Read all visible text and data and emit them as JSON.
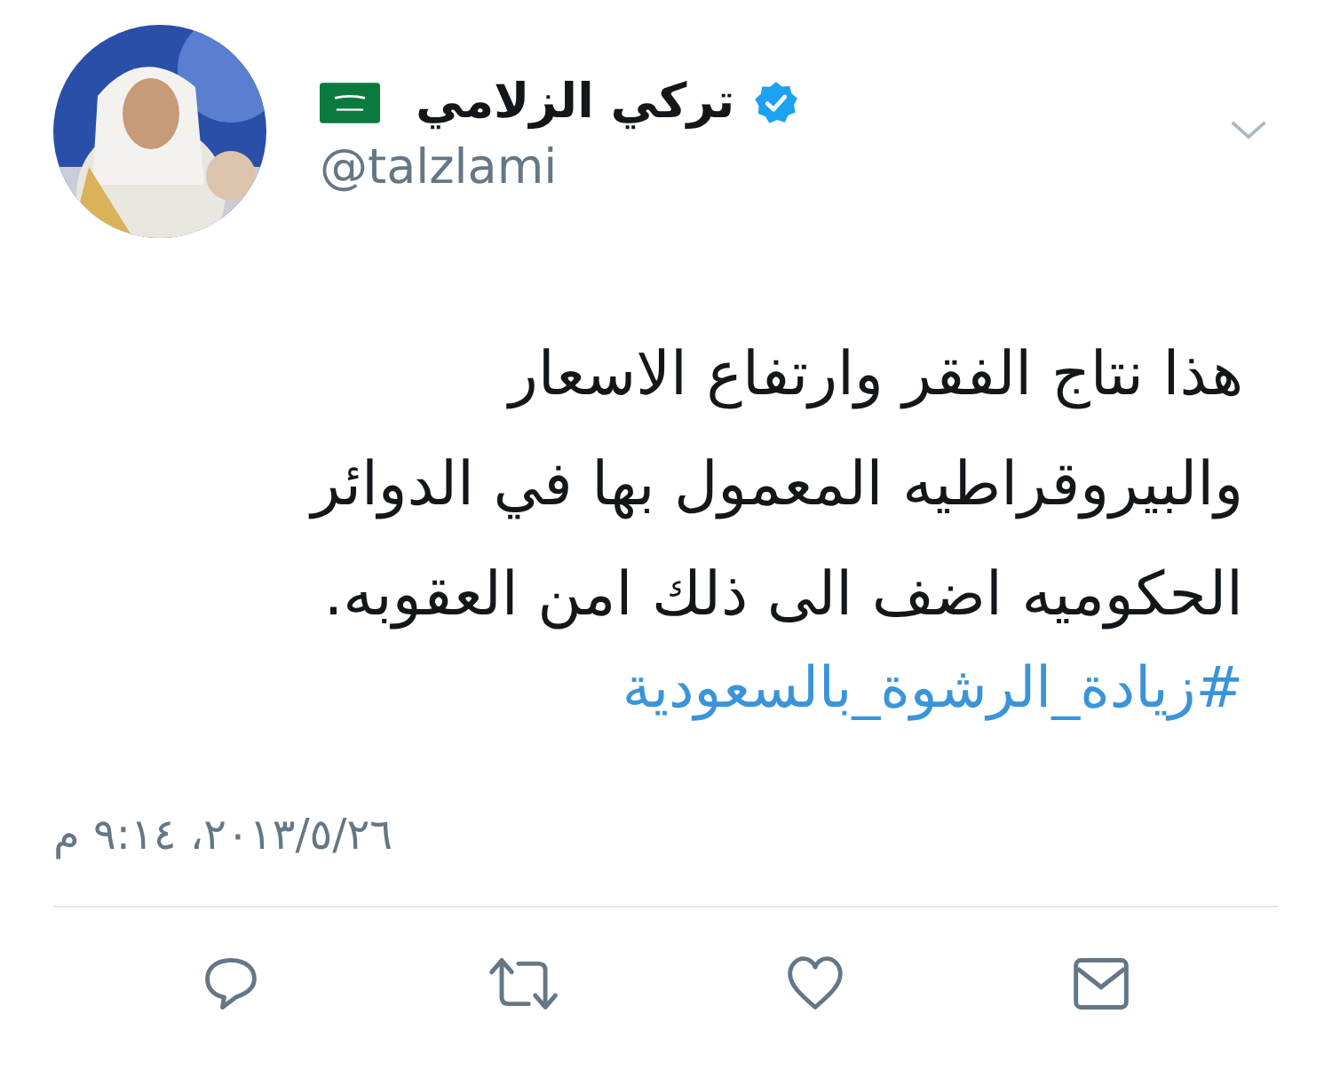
{
  "author": {
    "name": "تركي الزلامي",
    "handle": "@talzlami",
    "verified": true
  },
  "tweet": {
    "text": "هذا نتاج الفقر وارتفاع الاسعار\nوالبيروقراطيه المعمول بها في الدوائر\nالحكوميه اضف الى ذلك امن العقوبه.",
    "hashtag": "#زيادة_الرشوة_بالسعودية",
    "timestamp": "٢٠١٣/٥/٢٦، ٩:١٤ م"
  },
  "actions": [
    {
      "kind": "reply"
    },
    {
      "kind": "retweet"
    },
    {
      "kind": "like"
    },
    {
      "kind": "message"
    }
  ]
}
